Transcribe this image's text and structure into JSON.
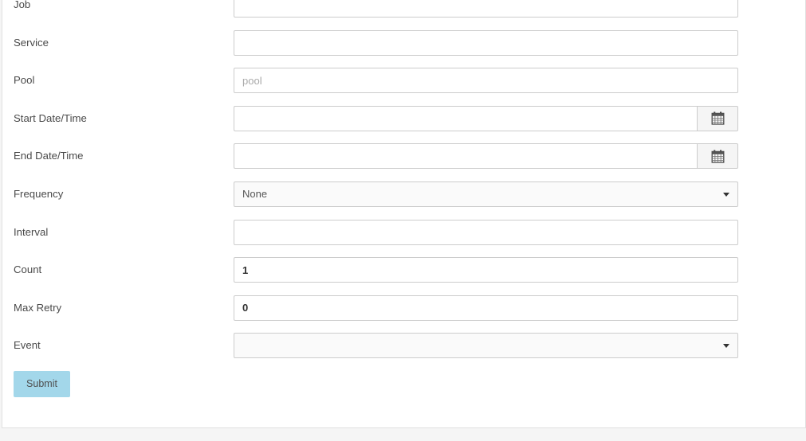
{
  "form": {
    "fields": [
      {
        "label": "Job",
        "type": "text",
        "value": "",
        "placeholder": ""
      },
      {
        "label": "Service",
        "type": "text",
        "value": "",
        "placeholder": ""
      },
      {
        "label": "Pool",
        "type": "text",
        "value": "",
        "placeholder": "pool"
      },
      {
        "label": "Start Date/Time",
        "type": "datetime",
        "value": "",
        "placeholder": "",
        "addon_icon": "calendar-icon"
      },
      {
        "label": "End Date/Time",
        "type": "datetime",
        "value": "",
        "placeholder": "",
        "addon_icon": "calendar-icon"
      },
      {
        "label": "Frequency",
        "type": "select",
        "value": "None",
        "caret_icon": "chevron-down-icon"
      },
      {
        "label": "Interval",
        "type": "text",
        "value": "",
        "placeholder": ""
      },
      {
        "label": "Count",
        "type": "text",
        "value": "1",
        "placeholder": ""
      },
      {
        "label": "Max Retry",
        "type": "text",
        "value": "0",
        "placeholder": ""
      },
      {
        "label": "Event",
        "type": "select",
        "value": "",
        "caret_icon": "chevron-down-icon"
      }
    ],
    "submit_label": "Submit"
  },
  "colors": {
    "submit_background": "#a3d7ea",
    "panel_background": "#ffffff",
    "page_background": "#f5f5f5",
    "input_border": "#cccccc",
    "select_background": "#fafafa",
    "label_text": "#4a4a4a",
    "placeholder_text": "#a9a9a9"
  }
}
